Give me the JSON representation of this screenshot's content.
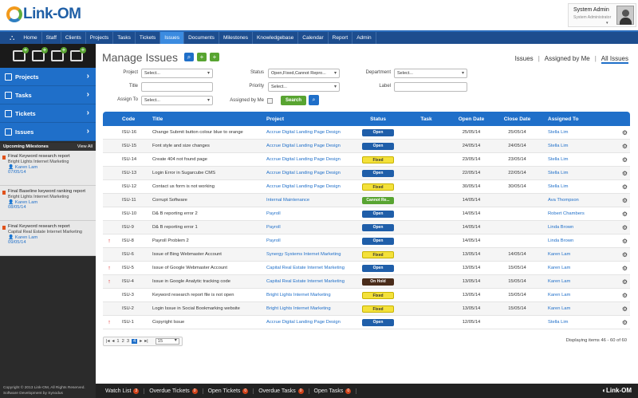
{
  "app": {
    "logo_text": "Link-OM"
  },
  "user": {
    "name": "System Admin",
    "role": "System Administrator"
  },
  "nav": {
    "items": [
      "Home",
      "Staff",
      "Clients",
      "Projects",
      "Tasks",
      "Tickets",
      "Issues",
      "Documents",
      "Milestones",
      "Knowledgebase",
      "Calendar",
      "Report",
      "Admin"
    ],
    "active": "Issues"
  },
  "sidebar": {
    "menu": [
      {
        "label": "Projects"
      },
      {
        "label": "Tasks"
      },
      {
        "label": "Tickets"
      },
      {
        "label": "Issues"
      }
    ],
    "milestones_title": "Upcoming Milestones",
    "view_all": "View All",
    "milestones": [
      {
        "title": "Final Keyword research report",
        "project": "Bright Lights Internet Marketing",
        "user": "Karen Lam",
        "date": "07/05/14"
      },
      {
        "title": "Final Baseline keyword ranking report",
        "project": "Bright Lights Internet Marketing",
        "user": "Karen Lam",
        "date": "08/05/14"
      },
      {
        "title": "Final Keyword research report",
        "project": "Capital Real Estate Internet Marketing",
        "user": "Karen Lam",
        "date": "09/05/14"
      }
    ],
    "copyright_1": "Copyright © 2013 Link-OM, All Rights Reserved.",
    "copyright_2": "Software Development by Synodus"
  },
  "page": {
    "title": "Manage Issues"
  },
  "views": {
    "issues": "Issues",
    "assigned": "Assigned by Me",
    "all": "All Issues"
  },
  "filters": {
    "project_label": "Project",
    "project_value": "Select...",
    "title_label": "Title",
    "title_value": "",
    "assign_label": "Assign To",
    "assign_value": "Select...",
    "status_label": "Status",
    "status_value": "Open,Fixed,Cannot Repro...",
    "priority_label": "Priority",
    "priority_value": "Select...",
    "assignedby_label": "Assigned by Me",
    "department_label": "Department",
    "department_value": "Select...",
    "label_label": "Label",
    "label_value": "",
    "search_button": "Search"
  },
  "table": {
    "columns": [
      "Code",
      "Title",
      "Project",
      "Status",
      "Task",
      "Open Date",
      "Close Date",
      "Assigned To"
    ],
    "rows": [
      {
        "up": false,
        "code": "ISU-16",
        "title": "Change Submit button colour blue to orange",
        "project": "Accrue Digital Landing Page Design",
        "status": "Open",
        "task": "",
        "open": "25/05/14",
        "close": "25/05/14",
        "assigned": "Stella Lim"
      },
      {
        "up": false,
        "code": "ISU-15",
        "title": "Font style and size changes",
        "project": "Accrue Digital Landing Page Design",
        "status": "Open",
        "task": "",
        "open": "24/05/14",
        "close": "24/05/14",
        "assigned": "Stella Lim"
      },
      {
        "up": false,
        "code": "ISU-14",
        "title": "Create 404 not found page",
        "project": "Accrue Digital Landing Page Design",
        "status": "Fixed",
        "task": "",
        "open": "23/05/14",
        "close": "23/05/14",
        "assigned": "Stella Lim"
      },
      {
        "up": false,
        "code": "ISU-13",
        "title": "Login Error in Sugarcube CMS",
        "project": "Accrue Digital Landing Page Design",
        "status": "Open",
        "task": "",
        "open": "22/05/14",
        "close": "22/05/14",
        "assigned": "Stella Lim"
      },
      {
        "up": false,
        "code": "ISU-12",
        "title": "Contact us form is not working",
        "project": "Accrue Digital Landing Page Design",
        "status": "Fixed",
        "task": "",
        "open": "30/05/14",
        "close": "30/05/14",
        "assigned": "Stella Lim"
      },
      {
        "up": false,
        "code": "ISU-11",
        "title": "Corrupt Software",
        "project": "Internal Maintenance",
        "status": "Cannot Re...",
        "task": "",
        "open": "14/05/14",
        "close": "",
        "assigned": "Ava Thompson"
      },
      {
        "up": false,
        "code": "ISU-10",
        "title": "D& B reporting error 2",
        "project": "Payroll",
        "status": "Open",
        "task": "",
        "open": "14/05/14",
        "close": "",
        "assigned": "Robert Chambers"
      },
      {
        "up": false,
        "code": "ISU-9",
        "title": "D& B reporting error 1",
        "project": "Payroll",
        "status": "Open",
        "task": "",
        "open": "14/05/14",
        "close": "",
        "assigned": "Linda Brown"
      },
      {
        "up": true,
        "code": "ISU-8",
        "title": "Payroll Problem 2",
        "project": "Payroll",
        "status": "Open",
        "task": "",
        "open": "14/05/14",
        "close": "",
        "assigned": "Linda Brown"
      },
      {
        "up": false,
        "code": "ISU-6",
        "title": "Issue of Bing Webmaster Account",
        "project": "Synergy Systems Internet Marketing",
        "status": "Fixed",
        "task": "",
        "open": "13/05/14",
        "close": "14/05/14",
        "assigned": "Karen Lam"
      },
      {
        "up": true,
        "code": "ISU-5",
        "title": "Issue of Google Webmaster Account",
        "project": "Capital Real Estate Internet Marketing",
        "status": "Open",
        "task": "",
        "open": "13/05/14",
        "close": "15/05/14",
        "assigned": "Karen Lam"
      },
      {
        "up": true,
        "code": "ISU-4",
        "title": "Issue in Google Analytic tracking code",
        "project": "Capital Real Estate Internet Marketing",
        "status": "On Hold",
        "task": "",
        "open": "13/05/14",
        "close": "15/05/14",
        "assigned": "Karen Lam"
      },
      {
        "up": false,
        "code": "ISU-3",
        "title": "Keyword research report file is not open",
        "project": "Bright Lights Internet Marketing",
        "status": "Fixed",
        "task": "",
        "open": "13/05/14",
        "close": "15/05/14",
        "assigned": "Karen Lam"
      },
      {
        "up": false,
        "code": "ISU-2",
        "title": "Login Issue in Social Bookmarking website",
        "project": "Bright Lights Internet Marketing",
        "status": "Fixed",
        "task": "",
        "open": "13/05/14",
        "close": "15/05/14",
        "assigned": "Karen Lam"
      },
      {
        "up": true,
        "code": "ISU-1",
        "title": "Copyright Issue",
        "project": "Accrue Digital Landing Page Design",
        "status": "Open",
        "task": "",
        "open": "12/05/14",
        "close": "",
        "assigned": "Stella Lim"
      }
    ]
  },
  "pager": {
    "pages": [
      "1",
      "2",
      "3",
      "4"
    ],
    "current": "4",
    "page_size": "15",
    "displaying": "Displaying items 46 - 60 of 60"
  },
  "footer": {
    "items": [
      {
        "label": "Watch List",
        "count": "3"
      },
      {
        "label": "Overdue Tickets",
        "count": "0"
      },
      {
        "label": "Open Tickets",
        "count": "0"
      },
      {
        "label": "Overdue Tasks",
        "count": "0"
      },
      {
        "label": "Open Tasks",
        "count": "0"
      }
    ],
    "logo": "Link-OM"
  }
}
